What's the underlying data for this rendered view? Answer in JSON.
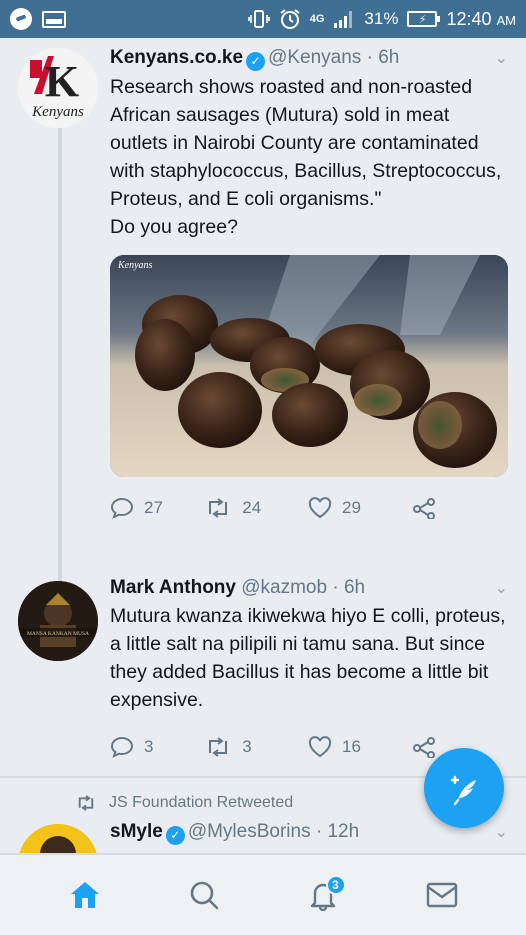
{
  "status_bar": {
    "network": "4G",
    "battery_percent": "31%",
    "time": "12:40",
    "ampm": "AM"
  },
  "tweets": [
    {
      "name": "Kenyans.co.ke",
      "handle": "@Kenyans",
      "time": "· 6h",
      "verified": true,
      "avatar_letter": "K",
      "avatar_caption": "Kenyans",
      "text": "Research shows roasted and non-roasted African sausages (Mutura) sold in meat outlets in Nairobi County are contaminated with staphylococcus, Bacillus, Streptococcus, Proteus, and E coli organisms.\"",
      "text_2": "Do you agree?",
      "media_watermark": "Kenyans",
      "replies": "27",
      "retweets": "24",
      "likes": "29"
    },
    {
      "name": "Mark Anthony",
      "handle": "@kazmob",
      "time": "· 6h",
      "avatar_caption": "MANSA KANKAN MUSA",
      "text": "Mutura kwanza ikiwekwa hiyo E colli, proteus, a little salt na pilipili ni tamu sana. But since they added Bacillus it has become a little bit expensive.",
      "replies": "3",
      "retweets": "3",
      "likes": "16"
    },
    {
      "retweeted_by": "JS Foundation Retweeted",
      "name": "sMyle",
      "handle": "@MylesBorins",
      "time": "· 12h",
      "verified": true
    }
  ],
  "nav": {
    "notifications_badge": "3"
  },
  "colors": {
    "accent": "#1da1f2",
    "status_bar": "#3f6f93",
    "muted_text": "#657786"
  }
}
